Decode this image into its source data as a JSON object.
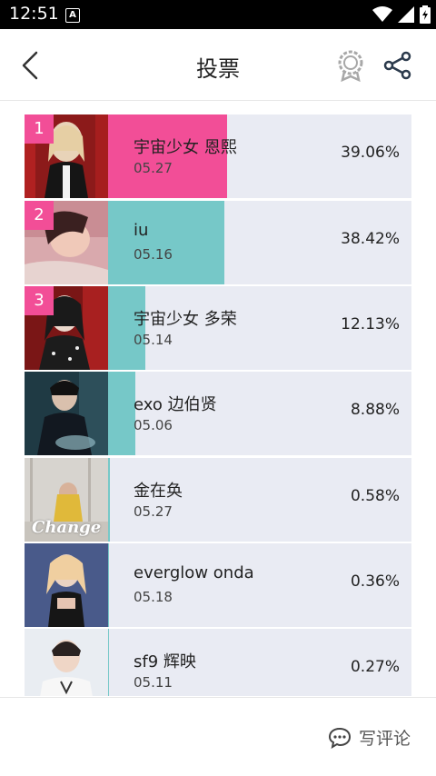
{
  "status_bar": {
    "time": "12:51",
    "a_badge": "A"
  },
  "header": {
    "title": "投票"
  },
  "colors": {
    "rank_pink": "#f24e97",
    "bar_pink": "#f24e97",
    "bar_teal": "#76c8c8",
    "row_bg": "#e9ebf3"
  },
  "entries": [
    {
      "rank": "1",
      "name": "宇宙少女 恩熙",
      "date": "05.27",
      "percent": "39.06%",
      "share": 0.3906
    },
    {
      "rank": "2",
      "name": "iu",
      "date": "05.16",
      "percent": "38.42%",
      "share": 0.3842
    },
    {
      "rank": "3",
      "name": "宇宙少女 多荣",
      "date": "05.14",
      "percent": "12.13%",
      "share": 0.1213
    },
    {
      "rank": "",
      "name": "exo 边伯贤",
      "date": "05.06",
      "percent": "8.88%",
      "share": 0.0888
    },
    {
      "rank": "",
      "name": "金在奂",
      "date": "05.27",
      "percent": "0.58%",
      "share": 0.0058,
      "thumb_text": "Change"
    },
    {
      "rank": "",
      "name": "everglow onda",
      "date": "05.18",
      "percent": "0.36%",
      "share": 0.0036
    },
    {
      "rank": "",
      "name": "sf9 辉映",
      "date": "05.11",
      "percent": "0.27%",
      "share": 0.0027
    }
  ],
  "footer": {
    "comment_label": "写评论"
  }
}
